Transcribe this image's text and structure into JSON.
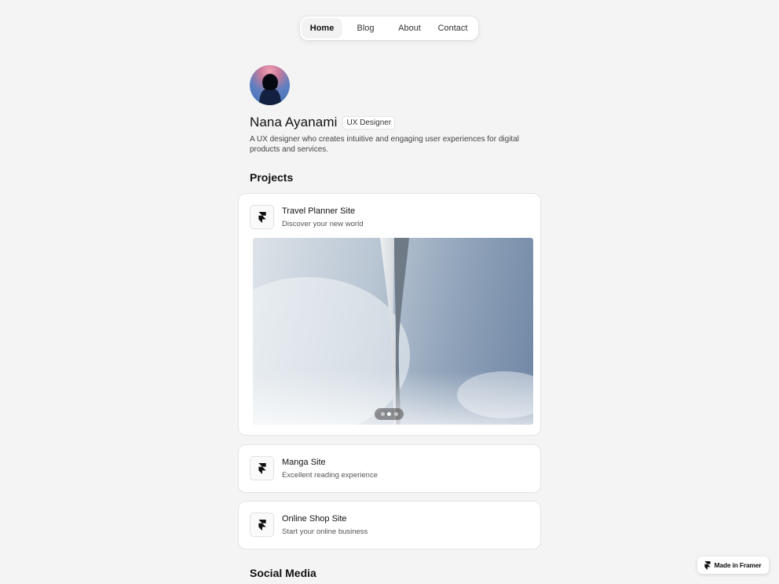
{
  "nav": {
    "items": [
      {
        "label": "Home",
        "active": true
      },
      {
        "label": "Blog",
        "active": false
      },
      {
        "label": "About",
        "active": false
      },
      {
        "label": "Contact",
        "active": false
      }
    ]
  },
  "profile": {
    "name": "Nana Ayanami",
    "role": "UX Designer",
    "bio": "A UX designer who creates intuitive and engaging user experiences for digital products and services."
  },
  "projects": {
    "title": "Projects",
    "items": [
      {
        "title": "Travel Planner Site",
        "subtitle": "Discover your new world",
        "icon": "framer-icon",
        "carousel": {
          "slides": 3,
          "active_index": 1
        }
      },
      {
        "title": "Manga Site",
        "subtitle": "Excellent reading experience",
        "icon": "framer-icon"
      },
      {
        "title": "Online Shop Site",
        "subtitle": "Start your online business",
        "icon": "framer-icon"
      }
    ]
  },
  "social": {
    "title": "Social Media"
  },
  "badge": {
    "label": "Made in Framer",
    "icon": "framer-icon"
  }
}
